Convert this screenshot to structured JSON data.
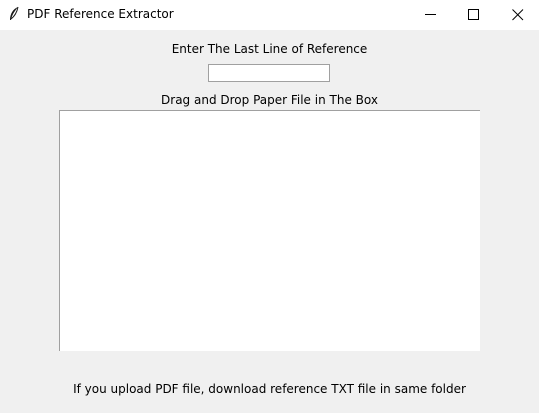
{
  "window": {
    "title": "PDF Reference Extractor",
    "icon": "feather-icon"
  },
  "reference": {
    "label": "Enter The Last Line of Reference",
    "value": "",
    "placeholder": ""
  },
  "dropzone": {
    "label": "Drag and Drop Paper File in The Box"
  },
  "footer": {
    "note": "If you upload PDF file, download reference TXT file in same folder"
  },
  "colors": {
    "background": "#f0f0f0",
    "titlebar": "#ffffff",
    "border": "#a0a0a0"
  }
}
